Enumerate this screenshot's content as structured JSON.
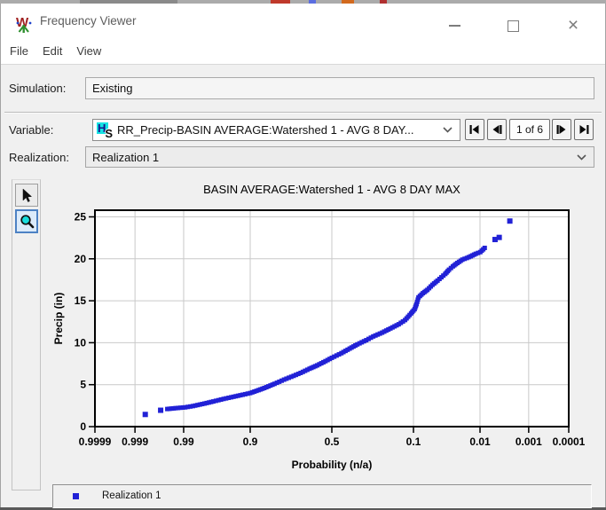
{
  "window": {
    "title": "Frequency Viewer"
  },
  "menu": {
    "items": [
      "File",
      "Edit",
      "View"
    ]
  },
  "form": {
    "simulation_label": "Simulation:",
    "simulation_value": "Existing",
    "variable_label": "Variable:",
    "variable_value": "RR_Precip-BASIN AVERAGE:Watershed 1 - AVG 8 DAY...",
    "variable_icon": "hec-dss-record-icon",
    "pager": {
      "position": "1 of 6"
    },
    "realization_label": "Realization:",
    "realization_value": "Realization 1"
  },
  "toolbar": {
    "buttons": [
      {
        "name": "pointer-tool",
        "selected": false
      },
      {
        "name": "zoom-tool",
        "selected": true
      }
    ]
  },
  "chart_data": {
    "type": "scatter",
    "title": "BASIN AVERAGE:Watershed 1 - AVG 8 DAY MAX",
    "xlabel": "Probability (n/a)",
    "ylabel": "Precip (in)",
    "x_scale": "normal-probability-exceedance",
    "x_ticks": [
      "0.9999",
      "0.999",
      "0.99",
      "0.9",
      "0.5",
      "0.1",
      "0.01",
      "0.001",
      "0.0001"
    ],
    "y_ticks": [
      0,
      5,
      10,
      15,
      20,
      25
    ],
    "ylim": [
      0,
      25.8
    ],
    "grid": true,
    "legend": {
      "position": "bottom",
      "entries": [
        "Realization 1"
      ]
    },
    "series": [
      {
        "name": "Realization 1",
        "color": "#2121d6",
        "marker": "square",
        "points_dense": [
          [
            0.9951,
            2.1
          ],
          [
            0.9929,
            2.2
          ],
          [
            0.9893,
            2.3
          ],
          [
            0.9854,
            2.45
          ],
          [
            0.9772,
            2.75
          ],
          [
            0.9686,
            3.0
          ],
          [
            0.9554,
            3.3
          ],
          [
            0.9429,
            3.5
          ],
          [
            0.9192,
            3.8
          ],
          [
            0.9,
            4.0
          ],
          [
            0.8749,
            4.35
          ],
          [
            0.8554,
            4.6
          ],
          [
            0.8159,
            5.1
          ],
          [
            0.7734,
            5.6
          ],
          [
            0.7257,
            6.05
          ],
          [
            0.6879,
            6.4
          ],
          [
            0.6368,
            6.9
          ],
          [
            0.591,
            7.3
          ],
          [
            0.5398,
            7.8
          ],
          [
            0.5,
            8.2
          ],
          [
            0.4404,
            8.75
          ],
          [
            0.3897,
            9.3
          ],
          [
            0.3446,
            9.8
          ],
          [
            0.2946,
            10.3
          ],
          [
            0.2578,
            10.75
          ],
          [
            0.2148,
            11.2
          ],
          [
            0.1788,
            11.7
          ],
          [
            0.1469,
            12.2
          ],
          [
            0.1251,
            12.7
          ],
          [
            0.1066,
            13.5
          ],
          [
            0.0968,
            14.0
          ],
          [
            0.0918,
            14.6
          ],
          [
            0.0869,
            15.4
          ],
          [
            0.0764,
            15.9
          ],
          [
            0.0668,
            16.3
          ],
          [
            0.0571,
            16.9
          ],
          [
            0.0485,
            17.4
          ],
          [
            0.0427,
            17.8
          ],
          [
            0.0375,
            18.2
          ],
          [
            0.0329,
            18.7
          ],
          [
            0.0287,
            19.1
          ],
          [
            0.0244,
            19.5
          ],
          [
            0.0202,
            19.9
          ],
          [
            0.017,
            20.1
          ],
          [
            0.0146,
            20.3
          ],
          [
            0.0119,
            20.6
          ],
          [
            0.0099,
            20.8
          ],
          [
            0.0082,
            21.3
          ]
        ],
        "points_sparse": [
          [
            0.9983,
            1.45
          ],
          [
            0.9964,
            1.95
          ],
          [
            0.0052,
            22.3
          ],
          [
            0.0043,
            22.55
          ],
          [
            0.0026,
            24.5
          ]
        ]
      }
    ]
  }
}
